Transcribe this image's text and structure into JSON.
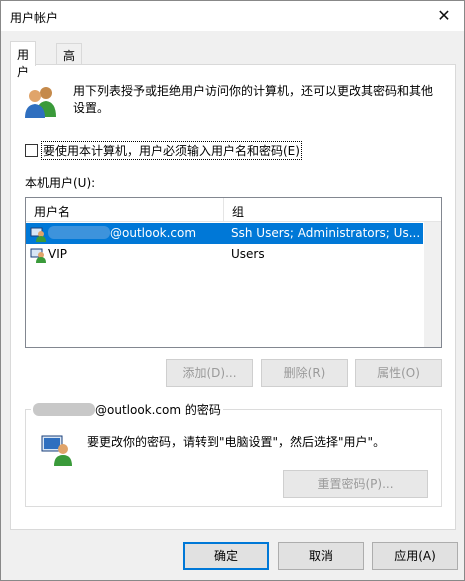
{
  "window": {
    "title": "用户帐户",
    "close_glyph": "✕"
  },
  "tabs": [
    {
      "label": "用户"
    },
    {
      "label": "高级"
    }
  ],
  "intro": {
    "text": "用下列表授予或拒绝用户访问你的计算机，还可以更改其密码和其他设置。"
  },
  "require_login": {
    "label": "要使用本计算机，用户必须输入用户名和密码(E)",
    "checked": false
  },
  "local_users": {
    "label": "本机用户(U):",
    "columns": [
      "用户名",
      "组"
    ],
    "rows": [
      {
        "name_suffix": "@outlook.com",
        "group": "Ssh Users; Administrators; Us...",
        "selected": true
      },
      {
        "name": "VIP",
        "group": "Users",
        "selected": false
      }
    ]
  },
  "buttons": {
    "add": "添加(D)...",
    "remove": "删除(R)",
    "properties": "属性(O)",
    "reset_password": "重置密码(P)...",
    "ok": "确定",
    "cancel": "取消",
    "apply": "应用(A)"
  },
  "password_group": {
    "title_suffix": "@outlook.com 的密码",
    "text": "要更改你的密码，请转到\"电脑设置\"，然后选择\"用户\"。"
  },
  "colors": {
    "selection": "#0078d7",
    "accent_border": "#0078d7"
  }
}
